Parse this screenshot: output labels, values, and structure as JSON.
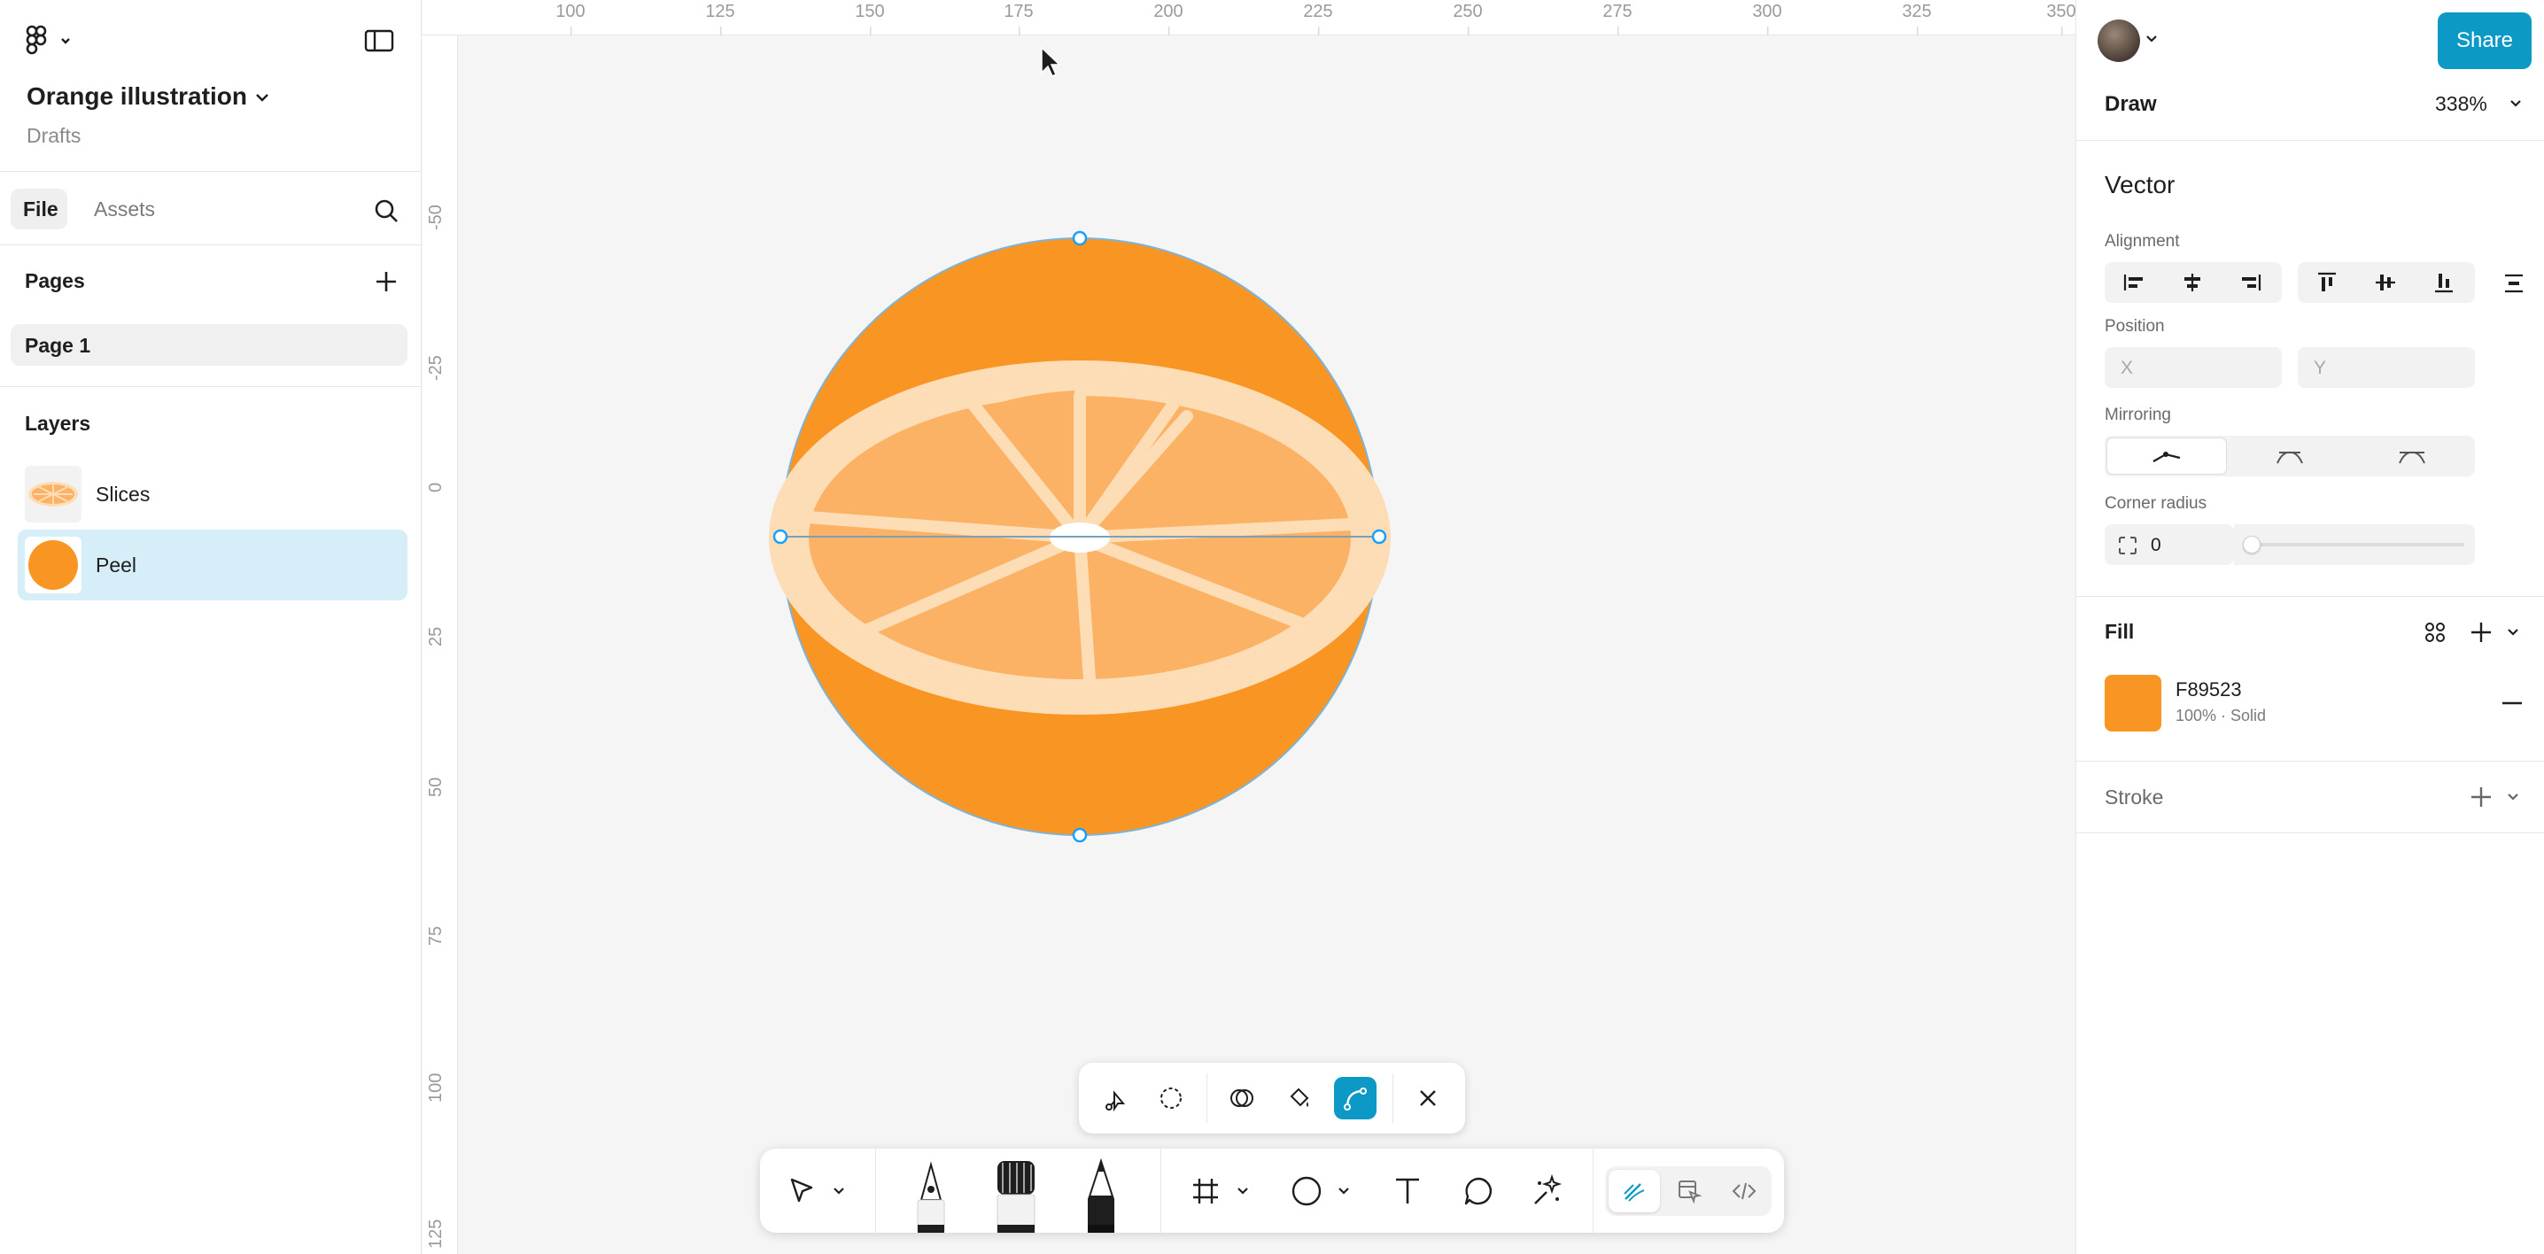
{
  "app": {
    "logo_icon": "figma-logo-icon"
  },
  "file": {
    "name": "Orange illustration",
    "location": "Drafts"
  },
  "left_tabs": {
    "file": "File",
    "assets": "Assets"
  },
  "pages": {
    "header": "Pages",
    "items": [
      {
        "label": "Page 1"
      }
    ]
  },
  "layers": {
    "header": "Layers",
    "items": [
      {
        "label": "Slices",
        "selected": false,
        "thumb": "orange-slice"
      },
      {
        "label": "Peel",
        "selected": true,
        "thumb": "orange-circle"
      }
    ]
  },
  "ruler": {
    "top": [
      "100",
      "125",
      "150",
      "175",
      "200",
      "225",
      "250",
      "275",
      "300",
      "325",
      "350"
    ],
    "left": [
      "-50",
      "-25",
      "0",
      "25",
      "50",
      "75",
      "100",
      "125"
    ]
  },
  "right": {
    "share": "Share",
    "mode": "Draw",
    "zoom": "338%",
    "section_title": "Vector",
    "alignment_label": "Alignment",
    "position_label": "Position",
    "x_placeholder": "X",
    "y_placeholder": "Y",
    "mirroring_label": "Mirroring",
    "corner_radius_label": "Corner radius",
    "corner_radius_value": "0",
    "fill_label": "Fill",
    "fill_hex": "F89523",
    "fill_detail": "100% · Solid",
    "stroke_label": "Stroke"
  },
  "colors": {
    "accent": "#0d99c6",
    "orange_peel": "#F89523",
    "slice_light": "#FBB265",
    "pith": "#FDDDB5",
    "selection": "#D6EEF7",
    "selection_handle": "#18A0FB"
  },
  "toolbar": {
    "context_tools": [
      "point-select-icon",
      "lasso-icon",
      "shape-builder-icon",
      "paint-bucket-icon",
      "bend-tool-icon",
      "close-icon"
    ],
    "main_tools": [
      "move-tool-icon",
      "pen-tool-icon",
      "brush-tool-icon",
      "pencil-tool-icon",
      "frame-tool-icon",
      "ellipse-tool-icon",
      "text-tool-icon",
      "comment-tool-icon",
      "ai-tool-icon",
      "draw-mode-icon",
      "design-mode-icon",
      "dev-mode-icon"
    ]
  }
}
